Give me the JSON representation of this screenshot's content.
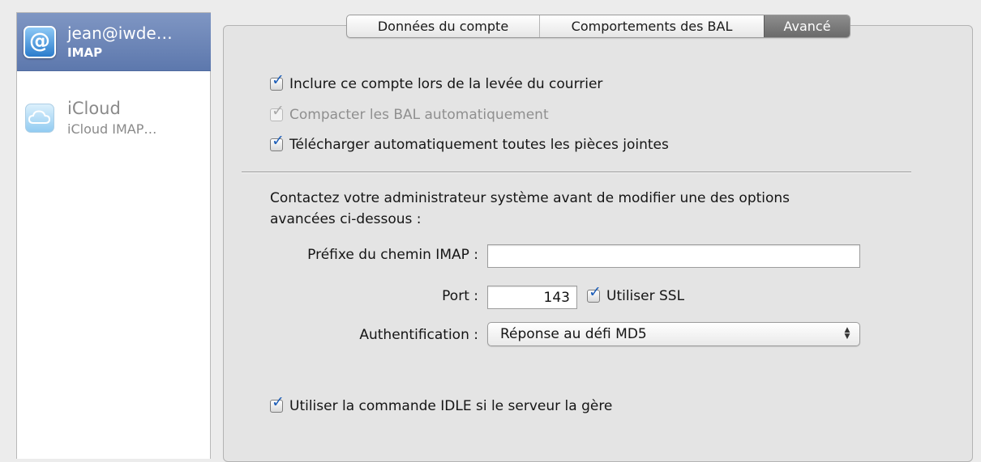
{
  "sidebar": {
    "accounts": [
      {
        "name": "jean@iwde…",
        "type": "IMAP",
        "icon": "at-sign-icon",
        "selected": true
      },
      {
        "name": "iCloud",
        "type": "iCloud IMAP…",
        "icon": "cloud-icon",
        "selected": false
      }
    ]
  },
  "tabs": [
    {
      "label": "Données du compte",
      "active": false
    },
    {
      "label": "Comportements des BAL",
      "active": false
    },
    {
      "label": "Avancé",
      "active": true
    }
  ],
  "options": {
    "include_account": {
      "label": "Inclure ce compte lors de la levée du courrier",
      "checked": true,
      "enabled": true
    },
    "compact_mailboxes": {
      "label": "Compacter les BAL automatiquement",
      "checked": true,
      "enabled": false
    },
    "download_attachments": {
      "label": "Télécharger automatiquement toutes les pièces jointes",
      "checked": true,
      "enabled": true
    }
  },
  "notice": "Contactez votre administrateur système avant de modifier une des options avancées ci-dessous :",
  "form": {
    "imap_prefix": {
      "label": "Préfixe du chemin IMAP :",
      "value": ""
    },
    "port": {
      "label": "Port :",
      "value": "143"
    },
    "use_ssl": {
      "label": "Utiliser SSL",
      "checked": true
    },
    "authentication": {
      "label": "Authentification :",
      "value": "Réponse au défi MD5"
    },
    "use_idle": {
      "label": "Utiliser la commande IDLE si le serveur la gère",
      "checked": true
    }
  },
  "colors": {
    "selection": "#6b84b8",
    "checkmark": "#1f5fb8",
    "active_tab": "#7a7a7a"
  }
}
